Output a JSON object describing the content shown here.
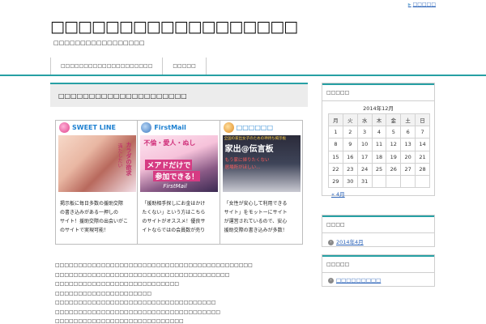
{
  "header": {
    "top_link": "□□□□□",
    "site_title": "□□□□□□□□□□□□□□□□□□",
    "site_desc": "□□□□□□□□□□□□□□□□□"
  },
  "nav": {
    "items": [
      "□□□□□□□□□□□□□□□□□□□□",
      "□□□□□"
    ]
  },
  "post": {
    "title": "□□□□□□□□□□□□□□□□□□□□□",
    "banners": [
      {
        "name": "SWEET LINE",
        "icon": "pink-heart-icon",
        "img_lines": [
          "カラダの欲求",
          "満たしたい"
        ],
        "text_lines": [
          "掲示板に毎日多数の援助交際",
          "の書き込みがある一押しの",
          "サイト！援助交際の出会いがこ",
          "のサイトで実現可能！"
        ]
      },
      {
        "name": "FirstMail",
        "icon": "blue-person-icon",
        "img_lines": [
          "不倫・愛人・ぬし",
          "メアドだけで",
          "参加できる！",
          "FirstMail"
        ],
        "text_lines": [
          "「援助相手探しにお金はかけ",
          "たくない」という方はこちら",
          "のサイトがオススメ！優良サ",
          "イトならではの会員数が売り"
        ]
      },
      {
        "name": "□□□□□□",
        "icon": "orange-flower-icon",
        "img_lines": [
          "全国の家出女子のための神待ち掲示板",
          "家出@伝言板",
          "もう家に帰りたくない",
          "居場所がほしい…"
        ],
        "text_lines": [
          "「女性が安心して利用できる",
          "サイト」をモットーにサイト",
          "が運営されているので、安心",
          "援助交際の書き込みが多数！"
        ]
      }
    ],
    "body_lines": [
      "□□□□□□□□□□□□□□□□□□□□□□□□□□□□□□□□□□□□□□□□□□□",
      "□□□□□□□□□□□□□□□□□□□□□□□□□□□□□□□□□□□□□□",
      "□□□□□□□□□□□□□□□□□□□□□□□□□□□",
      "□□□□□□□□□□□□□□□□□□□□□",
      "□□□□□□□□□□□□□□□□□□□□□□□□□□□□□□□□□□□",
      "□□□□□□□□□□□□□□□□□□□□□□□□□□□□□□□□□□□□",
      "□□□□□□□□□□□□□□□□□□□□□□□□□□□□"
    ]
  },
  "sidebar": {
    "calendar": {
      "heading": "□□□□□",
      "caption": "2014年12月",
      "weekdays": [
        "月",
        "火",
        "水",
        "木",
        "金",
        "土",
        "日"
      ],
      "weeks": [
        [
          "1",
          "2",
          "3",
          "4",
          "5",
          "6",
          "7"
        ],
        [
          "8",
          "9",
          "10",
          "11",
          "12",
          "13",
          "14"
        ],
        [
          "15",
          "16",
          "17",
          "18",
          "19",
          "20",
          "21"
        ],
        [
          "22",
          "23",
          "24",
          "25",
          "26",
          "27",
          "28"
        ],
        [
          "29",
          "30",
          "31",
          "",
          "",
          "",
          ""
        ]
      ],
      "prev": "« 4月"
    },
    "archives": {
      "heading": "□□□□",
      "items": [
        "2014年4月"
      ]
    },
    "categories": {
      "heading": "□□□□□",
      "items": [
        "□□□□□□□□□"
      ]
    }
  },
  "colors": {
    "accent": "#27a0a4",
    "link": "#2b63b8",
    "banner_name": "#1b7fd0"
  }
}
